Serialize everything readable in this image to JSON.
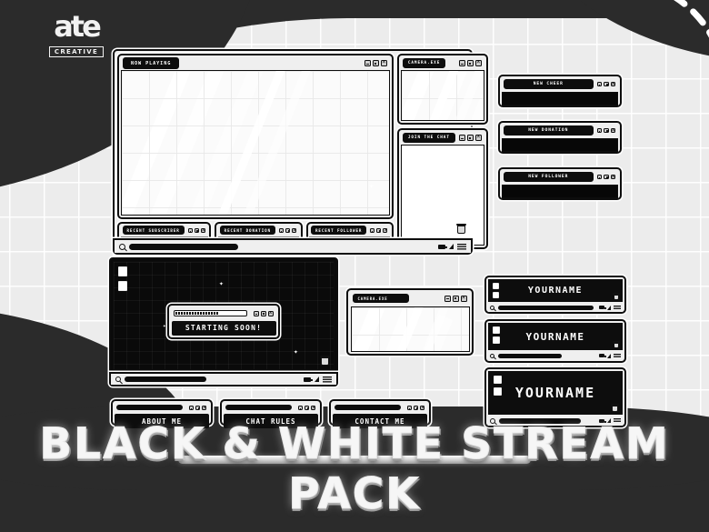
{
  "brand": {
    "mark": "ate",
    "badge": "CREATIVE"
  },
  "footer": {
    "title": "BLACK & WHITE STREAM PACK"
  },
  "main_window": {
    "now_playing": {
      "title": "NOW PLAYING"
    },
    "camera": {
      "title": "CAMERA.EXE"
    },
    "chat": {
      "title": "JOIN THE CHAT"
    },
    "bottom_bars": [
      {
        "title": "RECENT SUBSCRIBER"
      },
      {
        "title": "RECENT DONATION"
      },
      {
        "title": "RECENT FOLLOWER"
      }
    ],
    "taskbar": {
      "search_icon": "search-icon",
      "battery_icon": "battery-icon",
      "wifi_icon": "wifi-icon",
      "menu_icon": "hamburger-menu-icon",
      "trash_icon": "trash-icon"
    }
  },
  "alerts": [
    {
      "title": "NEW CHEER"
    },
    {
      "title": "NEW DONATION"
    },
    {
      "title": "NEW FOLLOWER"
    }
  ],
  "starting_soon": {
    "overlay_label": "STARTING SOON!",
    "progress": 62,
    "desktop_icons": [
      "file-icon",
      "file-icon"
    ]
  },
  "camera_small": {
    "title": "CAMERA.EXE"
  },
  "buttons": [
    {
      "label": "ABOUT ME"
    },
    {
      "label": "CHAT RULES"
    },
    {
      "label": "CONTACT ME"
    }
  ],
  "banners": [
    {
      "label": "YOURNAME",
      "size": "small"
    },
    {
      "label": "YOURNAME",
      "size": "medium"
    },
    {
      "label": "YOURNAME",
      "size": "large"
    }
  ],
  "colors": {
    "ink": "#0d0d0d",
    "paper": "#efefef",
    "backdrop": "#2b2b2b",
    "grid": "#ececec"
  }
}
